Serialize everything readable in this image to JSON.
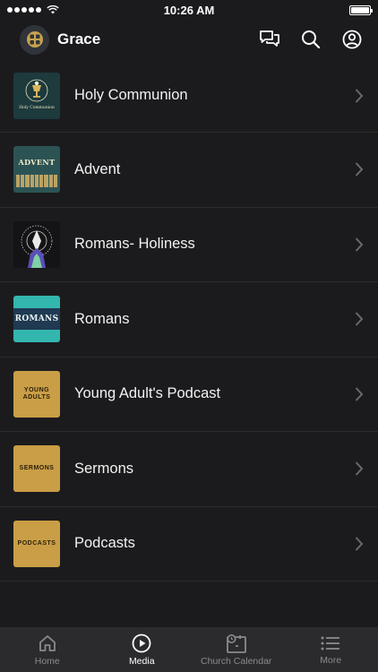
{
  "status_bar": {
    "time": "10:26 AM"
  },
  "header": {
    "app_name": "Grace"
  },
  "media_items": [
    {
      "label": "Holy Communion",
      "thumb_caption": "Holy Communion"
    },
    {
      "label": "Advent",
      "thumb_caption": "ADVENT"
    },
    {
      "label": "Romans- Holiness",
      "thumb_caption": ""
    },
    {
      "label": "Romans",
      "thumb_caption": "ROMANS"
    },
    {
      "label": "Young Adult's Podcast",
      "thumb_caption": "YOUNG ADULTS"
    },
    {
      "label": "Sermons",
      "thumb_caption": "SERMONS"
    },
    {
      "label": "Podcasts",
      "thumb_caption": "PODCASTS"
    }
  ],
  "tabs": [
    {
      "label": "Home",
      "icon": "home-icon",
      "active": false
    },
    {
      "label": "Media",
      "icon": "play-icon",
      "active": true
    },
    {
      "label": "Church Calendar",
      "icon": "calendar-icon",
      "active": false
    },
    {
      "label": "More",
      "icon": "list-icon",
      "active": false
    }
  ],
  "colors": {
    "background": "#1b1b1d",
    "tab_bar": "#2b2b2e",
    "gold_thumb": "#c99e46",
    "romans_teal": "#33b6ad",
    "inactive_tab": "#8b8b8e"
  }
}
